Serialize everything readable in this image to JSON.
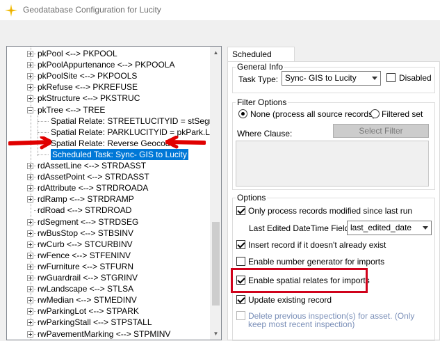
{
  "window": {
    "title": "Geodatabase Configuration for Lucity",
    "accent": "#0078d7"
  },
  "tree": {
    "rows": [
      {
        "label": "pkPool <--> PKPOOL",
        "kind": "plus"
      },
      {
        "label": "pkPoolAppurtenance <--> PKPOOLA",
        "kind": "plus"
      },
      {
        "label": "pkPoolSite <--> PKPOOLS",
        "kind": "plus"
      },
      {
        "label": "pkRefuse <--> PKREFUSE",
        "kind": "plus"
      },
      {
        "label": "pkStructure <--> PKSTRUC",
        "kind": "plus"
      },
      {
        "label": "pkTree <--> TREE",
        "kind": "minus"
      },
      {
        "label": "Spatial Relate: STREETLUCITYID = stSegment",
        "kind": "child"
      },
      {
        "label": "Spatial Relate: PARKLUCITYID = pkPark.Lucity",
        "kind": "child"
      },
      {
        "label": "Spatial Relate: Reverse Geocode",
        "kind": "child"
      },
      {
        "label": "Scheduled Task: Sync- GIS to Lucity",
        "kind": "child-selected"
      },
      {
        "label": "rdAssetLine <--> STRDASST",
        "kind": "plus"
      },
      {
        "label": "rdAssetPoint <--> STRDASST",
        "kind": "plus"
      },
      {
        "label": "rdAttribute <--> STRDROADA",
        "kind": "plus"
      },
      {
        "label": "rdRamp <--> STRDRAMP",
        "kind": "plus"
      },
      {
        "label": "rdRoad <--> STRDROAD",
        "kind": "none"
      },
      {
        "label": "rdSegment <--> STRDSEG",
        "kind": "plus"
      },
      {
        "label": "rwBusStop <--> STBSINV",
        "kind": "plus"
      },
      {
        "label": "rwCurb <--> STCURBINV",
        "kind": "plus"
      },
      {
        "label": "rwFence <--> STFENINV",
        "kind": "plus"
      },
      {
        "label": "rwFurniture <--> STFURN",
        "kind": "plus"
      },
      {
        "label": "rwGuardrail <--> STGRINV",
        "kind": "plus"
      },
      {
        "label": "rwLandscape <--> STLSA",
        "kind": "plus"
      },
      {
        "label": "rwMedian <--> STMEDINV",
        "kind": "plus"
      },
      {
        "label": "rwParkingLot <--> STPARK",
        "kind": "plus"
      },
      {
        "label": "rwParkingStall <--> STPSTALL",
        "kind": "plus"
      },
      {
        "label": "rwPavementMarking <--> STPMINV",
        "kind": "plus"
      }
    ]
  },
  "tabs": {
    "active": "Scheduled Tasks"
  },
  "general": {
    "group_title": "General Info",
    "task_type_label": "Task Type:",
    "task_type_value": "Sync- GIS to Lucity",
    "disabled_label": "Disabled",
    "disabled_checked": false
  },
  "filter": {
    "group_title": "Filter Options",
    "none_label": "None (process all source records)",
    "none_checked": true,
    "filtered_label": "Filtered set",
    "filtered_checked": false,
    "where_label": "Where Clause:",
    "select_filter_label": "Select Filter",
    "where_value": ""
  },
  "options": {
    "group_title": "Options",
    "only_modified_label": "Only process records modified since last run",
    "only_modified_checked": true,
    "last_edited_label": "Last Edited DateTime Field:",
    "last_edited_value": "last_edited_date",
    "insert_label": "Insert record if it doesn't already exist",
    "insert_checked": true,
    "number_gen_label": "Enable number generator for imports",
    "number_gen_checked": false,
    "spatial_relates_label": "Enable spatial relates for imports",
    "spatial_relates_checked": true,
    "update_label": "Update existing record",
    "update_checked": true,
    "delete_label_line1": "Delete previous inspection(s) for asset.  (Only",
    "delete_label_line2": "keep most recent inspection)",
    "delete_checked": false
  },
  "colors": {
    "highlight": "#d0021b",
    "selection": "#0078d7"
  }
}
